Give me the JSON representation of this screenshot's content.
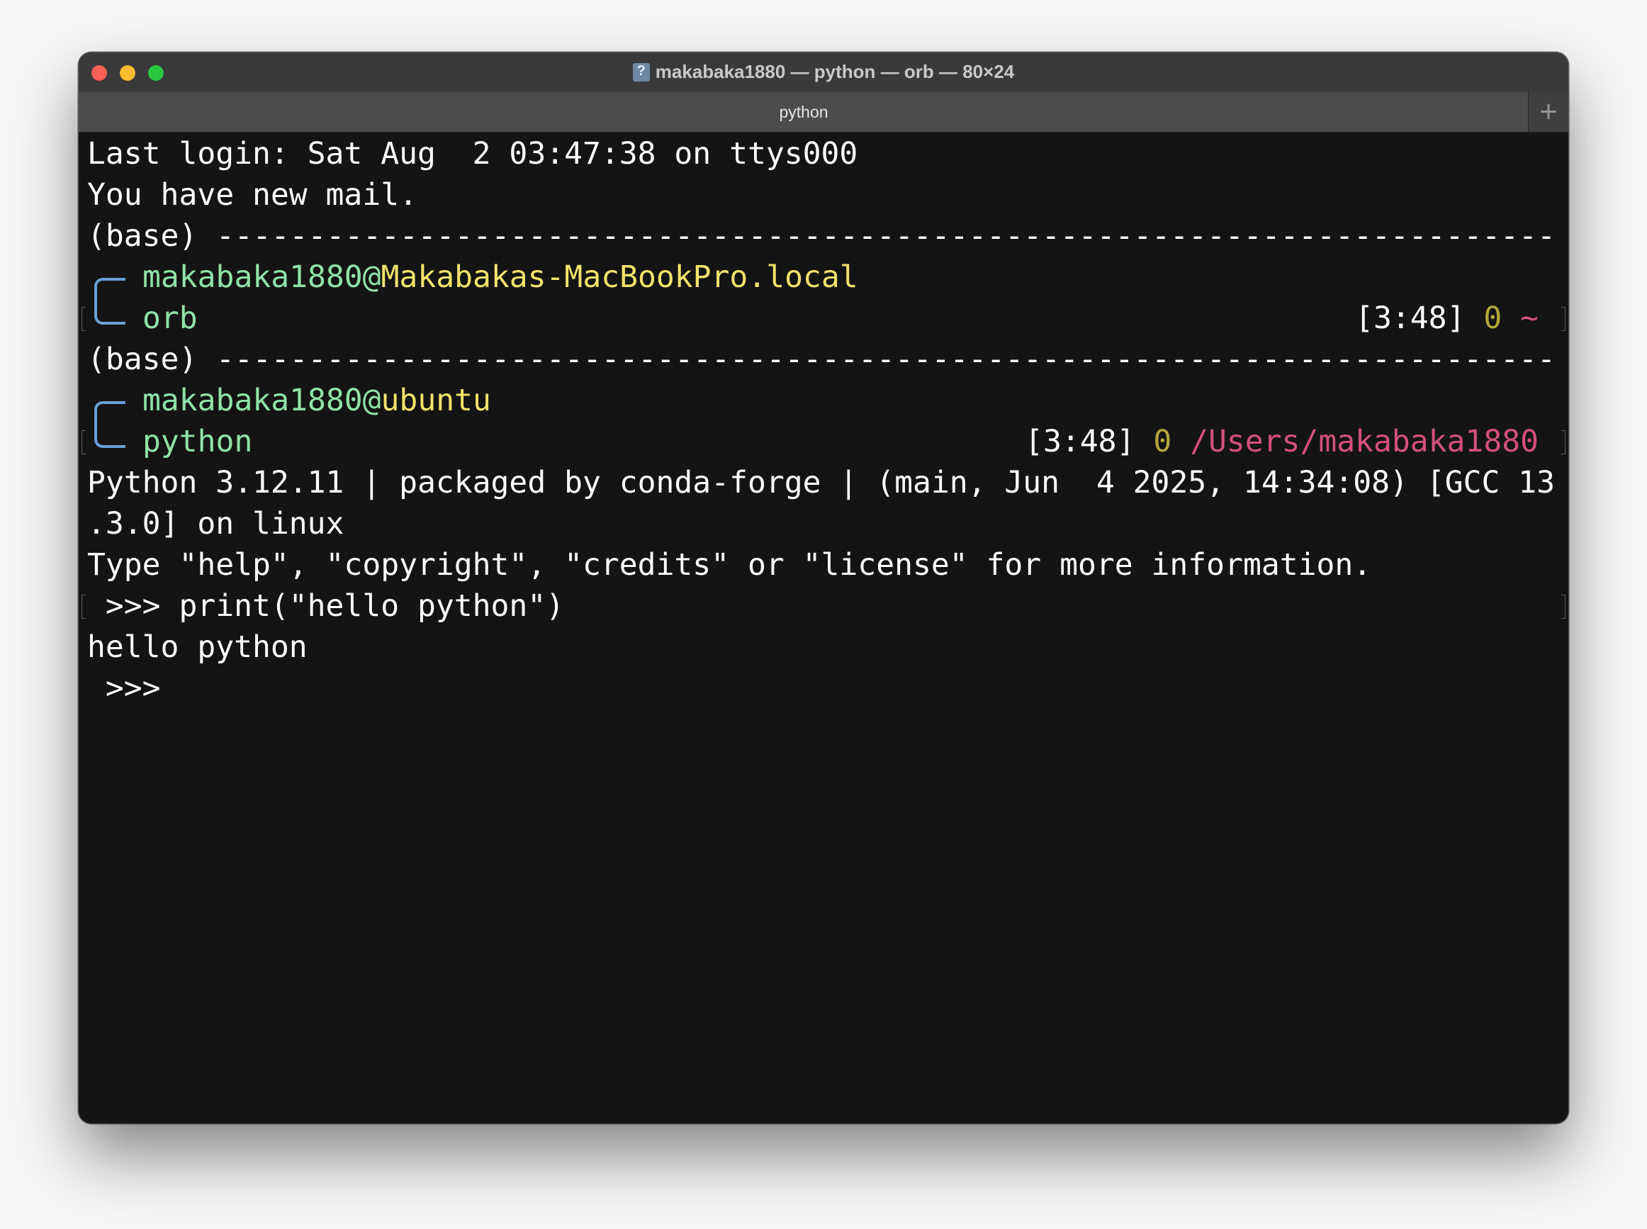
{
  "window": {
    "title": "makabaka1880 — python — orb — 80×24",
    "tab_label": "python",
    "new_tab_symbol": "+"
  },
  "terminal": {
    "line_last_login": "Last login: Sat Aug  2 03:47:38 on ttys000",
    "line_mail": "You have new mail.",
    "prompt1": {
      "env": "(base)",
      "separator": "---------------------------------------------------------------------------",
      "user": "makabaka1880@",
      "host": "Makabakas-MacBookPro.local",
      "command": "orb",
      "time": "[3:48]",
      "exit_code": "0",
      "cwd": "~"
    },
    "prompt2": {
      "env": "(base)",
      "separator": "---------------------------------------------------------------------------",
      "user": "makabaka1880@",
      "host": "ubuntu",
      "command": "python",
      "time": "[3:48]",
      "exit_code": "0",
      "cwd": "/Users/makabaka1880"
    },
    "python_banner_1": "Python 3.12.11 | packaged by conda-forge | (main, Jun  4 2025, 14:34:08) [GCC 13",
    "python_banner_2": ".3.0] on linux",
    "python_banner_3": "Type \"help\", \"copyright\", \"credits\" or \"license\" for more information.",
    "repl_input": " >>> print(\"hello python\")",
    "repl_output": "hello python",
    "repl_prompt": " >>> "
  },
  "colors": {
    "user": "#8fe3a8",
    "host": "#f2e36a",
    "exit_code": "#b3a93a",
    "cwd": "#d4507a",
    "bracket": "#6a9fd8"
  }
}
